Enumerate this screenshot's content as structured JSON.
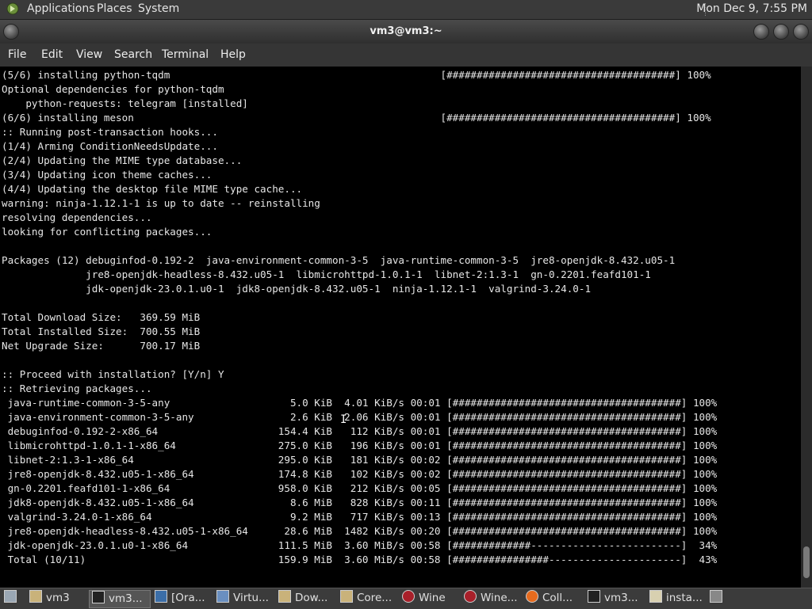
{
  "top_panel": {
    "menus": [
      "Applications",
      "Places",
      "System"
    ],
    "clock": "Mon Dec 9, 7:55 PM"
  },
  "window": {
    "title": "vm3@vm3:~"
  },
  "menubar": [
    "File",
    "Edit",
    "View",
    "Search",
    "Terminal",
    "Help"
  ],
  "terminal": {
    "lines": [
      "(5/6) installing python-tqdm                                             [######################################] 100%",
      "Optional dependencies for python-tqdm",
      "    python-requests: telegram [installed]",
      "(6/6) installing meson                                                   [######################################] 100%",
      ":: Running post-transaction hooks...",
      "(1/4) Arming ConditionNeedsUpdate...",
      "(2/4) Updating the MIME type database...",
      "(3/4) Updating icon theme caches...",
      "(4/4) Updating the desktop file MIME type cache...",
      "warning: ninja-1.12.1-1 is up to date -- reinstalling",
      "resolving dependencies...",
      "looking for conflicting packages...",
      "",
      "Packages (12) debuginfod-0.192-2  java-environment-common-3-5  java-runtime-common-3-5  jre8-openjdk-8.432.u05-1",
      "              jre8-openjdk-headless-8.432.u05-1  libmicrohttpd-1.0.1-1  libnet-2:1.3-1  gn-0.2201.feafd101-1",
      "              jdk-openjdk-23.0.1.u0-1  jdk8-openjdk-8.432.u05-1  ninja-1.12.1-1  valgrind-3.24.0-1",
      "",
      "Total Download Size:   369.59 MiB",
      "Total Installed Size:  700.55 MiB",
      "Net Upgrade Size:      700.17 MiB",
      "",
      ":: Proceed with installation? [Y/n] Y",
      ":: Retrieving packages...",
      " java-runtime-common-3-5-any                    5.0 KiB  4.01 KiB/s 00:01 [######################################] 100%",
      " java-environment-common-3-5-any                2.6 KiB  2.06 KiB/s 00:01 [######################################] 100%",
      " debuginfod-0.192-2-x86_64                    154.4 KiB   112 KiB/s 00:01 [######################################] 100%",
      " libmicrohttpd-1.0.1-1-x86_64                 275.0 KiB   196 KiB/s 00:01 [######################################] 100%",
      " libnet-2:1.3-1-x86_64                        295.0 KiB   181 KiB/s 00:02 [######################################] 100%",
      " jre8-openjdk-8.432.u05-1-x86_64              174.8 KiB   102 KiB/s 00:02 [######################################] 100%",
      " gn-0.2201.feafd101-1-x86_64                  958.0 KiB   212 KiB/s 00:05 [######################################] 100%",
      " jdk8-openjdk-8.432.u05-1-x86_64                8.6 MiB   828 KiB/s 00:11 [######################################] 100%",
      " valgrind-3.24.0-1-x86_64                       9.2 MiB   717 KiB/s 00:13 [######################################] 100%",
      " jre8-openjdk-headless-8.432.u05-1-x86_64      28.6 MiB  1482 KiB/s 00:20 [######################################] 100%",
      " jdk-openjdk-23.0.1.u0-1-x86_64               111.5 MiB  3.60 MiB/s 00:58 [#############-------------------------]  34%",
      " Total (10/11)                                159.9 MiB  3.60 MiB/s 00:58 [################----------------------]  43%"
    ]
  },
  "taskbar": {
    "items": [
      {
        "label": "",
        "icon": "show-desktop-icon"
      },
      {
        "label": "vm3",
        "icon": "home-folder-icon"
      },
      {
        "label": "vm3...",
        "icon": "terminal-icon",
        "active": true
      },
      {
        "label": "[Ora...",
        "icon": "java-icon"
      },
      {
        "label": "Virtu...",
        "icon": "window-icon"
      },
      {
        "label": "Dow...",
        "icon": "folder-icon"
      },
      {
        "label": "Core...",
        "icon": "folder-icon"
      },
      {
        "label": "Wine",
        "icon": "wine-glass-icon"
      },
      {
        "label": "Wine...",
        "icon": "wine-glass-icon"
      },
      {
        "label": "Coll...",
        "icon": "firefox-icon"
      },
      {
        "label": "vm3...",
        "icon": "terminal-icon"
      },
      {
        "label": "insta...",
        "icon": "text-editor-icon"
      },
      {
        "label": "",
        "icon": "workspace-icon"
      }
    ]
  }
}
